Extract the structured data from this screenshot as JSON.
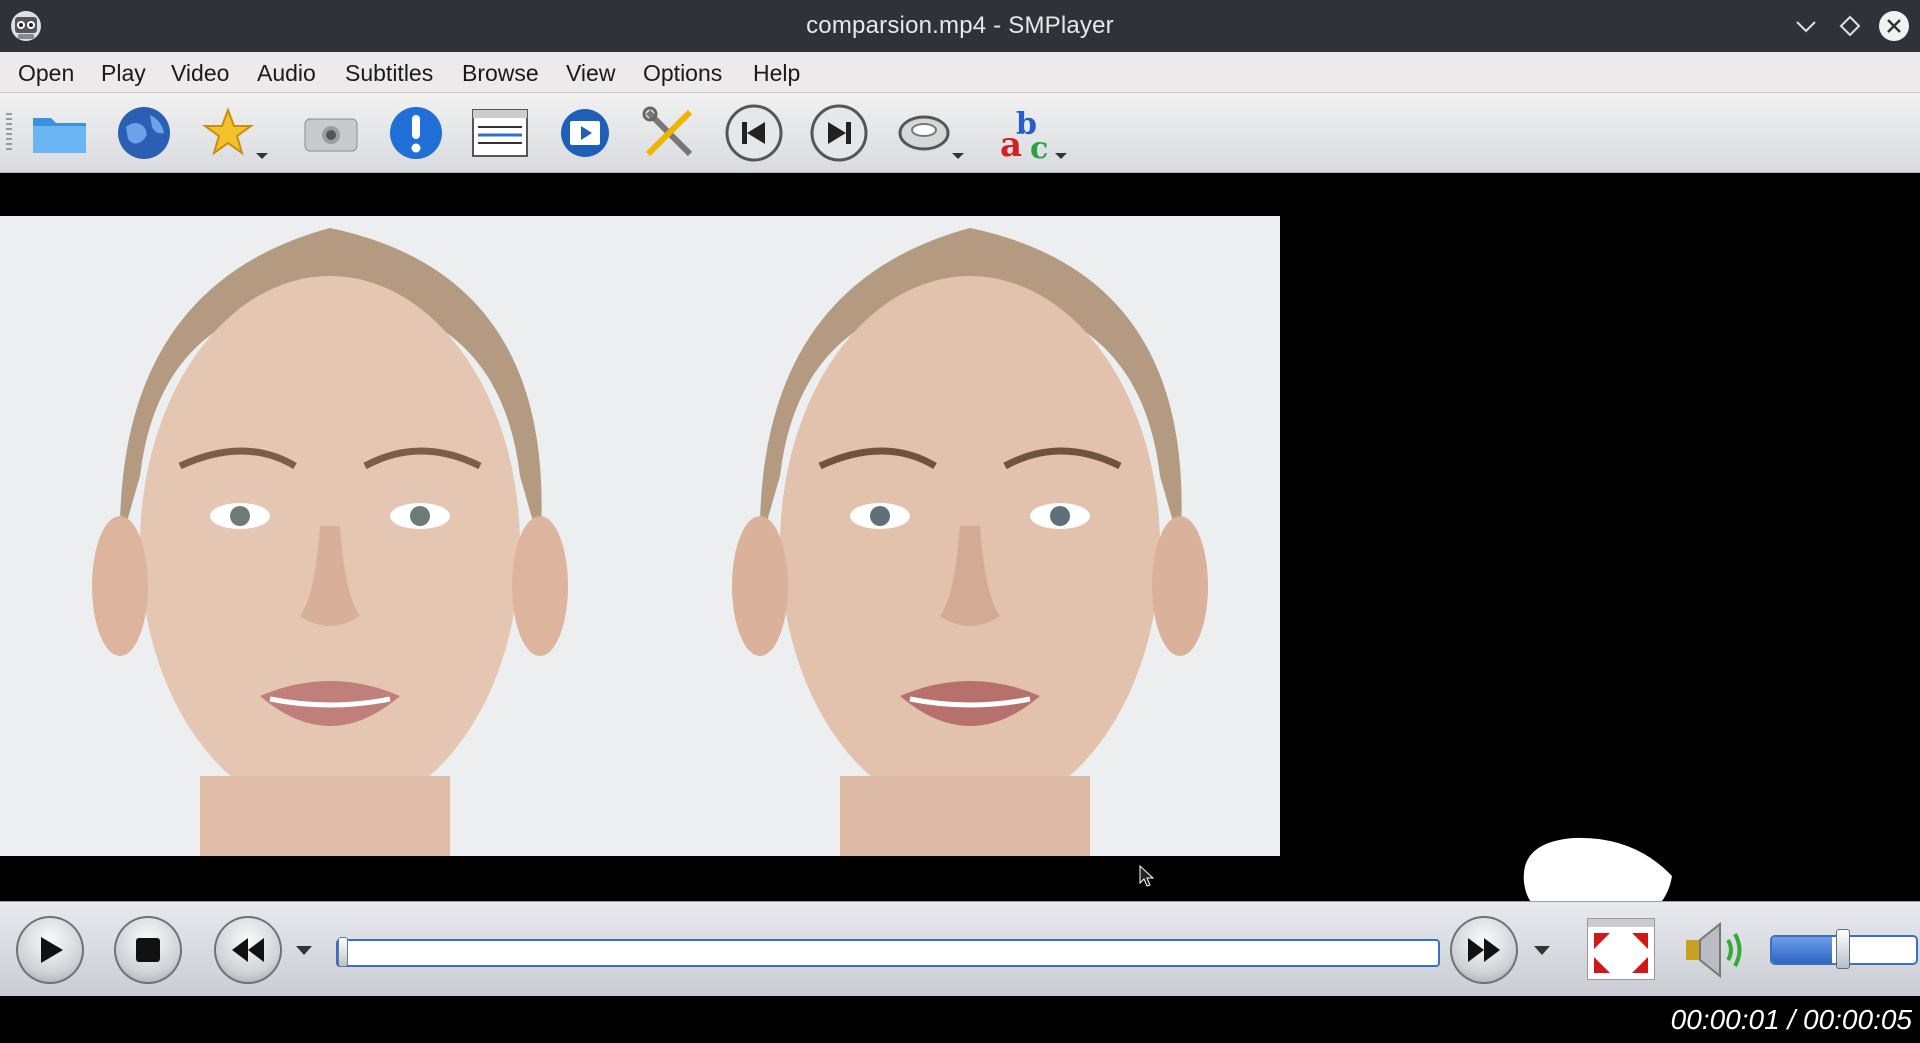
{
  "window": {
    "title": "comparsion.mp4 - SMPlayer"
  },
  "menu": [
    "Open",
    "Play",
    "Video",
    "Audio",
    "Subtitles",
    "Browse",
    "View",
    "Options",
    "Help"
  ],
  "toolbar": {
    "buttons": [
      "open-folder-icon",
      "open-url-icon",
      "favorites-icon",
      "screenshot-icon",
      "info-icon",
      "playlist-icon",
      "video-preview-icon",
      "preferences-icon",
      "previous-icon",
      "next-icon",
      "audio-track-icon",
      "subtitle-track-icon"
    ]
  },
  "playback": {
    "current_time": "00:00:01",
    "total_time": "00:00:05",
    "time_display": "00:00:01 / 00:00:05",
    "seek_position": 0.0,
    "volume": 0.42
  },
  "colors": {
    "accent": "#3a6fc4",
    "titlebar": "#2f3339"
  }
}
